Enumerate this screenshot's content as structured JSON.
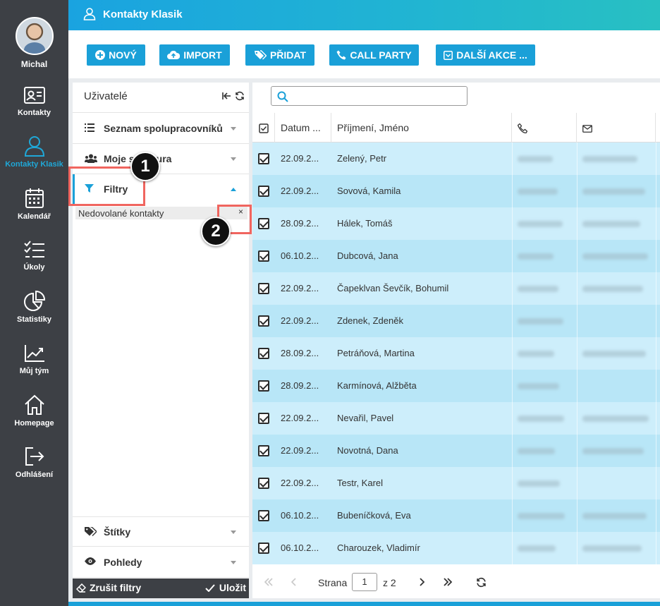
{
  "nav": {
    "user": {
      "name": "Michal"
    },
    "items": [
      {
        "label": "Kontakty",
        "icon": "contact-card-icon",
        "active": false
      },
      {
        "label": "Kontakty Klasik",
        "icon": "user-icon",
        "active": true
      },
      {
        "label": "Kalendář",
        "icon": "calendar-icon",
        "active": false
      },
      {
        "label": "Úkoly",
        "icon": "tasks-icon",
        "active": false
      },
      {
        "label": "Statistiky",
        "icon": "pie-chart-icon",
        "active": false
      },
      {
        "label": "Můj tým",
        "icon": "trend-chart-icon",
        "active": false
      },
      {
        "label": "Homepage",
        "icon": "home-icon",
        "active": false
      },
      {
        "label": "Odhlášení",
        "icon": "logout-icon",
        "active": false
      }
    ]
  },
  "header": {
    "title": "Kontakty Klasik",
    "icon": "user-icon"
  },
  "toolbar": {
    "buttons": [
      {
        "label": "NOVÝ",
        "icon": "plus-circle-icon"
      },
      {
        "label": "IMPORT",
        "icon": "cloud-upload-icon"
      },
      {
        "label": "PŘIDAT",
        "icon": "tags-icon"
      },
      {
        "label": "CALL PARTY",
        "icon": "phone-icon"
      },
      {
        "label": "DALŠÍ AKCE ...",
        "icon": "dropdown-box-icon"
      }
    ]
  },
  "filter_panel": {
    "title": "Uživatelé",
    "sections": [
      {
        "label": "Seznam spolupracovníků",
        "icon": "list-icon",
        "expanded": false
      },
      {
        "label": "Moje struktura",
        "icon": "users-icon",
        "expanded": false
      },
      {
        "label": "Filtry",
        "icon": "filter-icon",
        "expanded": true
      },
      {
        "label": "Štítky",
        "icon": "tag-icon",
        "expanded": false
      },
      {
        "label": "Pohledy",
        "icon": "eye-icon",
        "expanded": false
      }
    ],
    "active_filter": {
      "label": "Nedovolané kontakty",
      "remove": "×"
    },
    "footer": {
      "clear_label": "Zrušit filtry",
      "save_label": "Uložit"
    }
  },
  "search": {
    "placeholder": "",
    "value": ""
  },
  "table": {
    "columns": [
      "Datum ...",
      "Příjmení, Jméno"
    ],
    "rows": [
      {
        "date": "22.09.2...",
        "name": "Zelený, Petr",
        "email": true
      },
      {
        "date": "22.09.2...",
        "name": "Sovová, Kamila",
        "email": true
      },
      {
        "date": "28.09.2...",
        "name": "Hálek, Tomáš",
        "email": true
      },
      {
        "date": "06.10.2...",
        "name": "Dubcová, Jana",
        "email": true
      },
      {
        "date": "22.09.2...",
        "name": "Čapeklvan Ševčík, Bohumil",
        "email": true
      },
      {
        "date": "22.09.2...",
        "name": "Zdenek, Zdeněk",
        "email": false
      },
      {
        "date": "28.09.2...",
        "name": "Petráňová, Martina",
        "email": true
      },
      {
        "date": "28.09.2...",
        "name": "Karmínová, Alžběta",
        "email": false
      },
      {
        "date": "22.09.2...",
        "name": "Nevařil, Pavel",
        "email": true
      },
      {
        "date": "22.09.2...",
        "name": "Novotná, Dana",
        "email": true
      },
      {
        "date": "22.09.2...",
        "name": "Testr, Karel",
        "email": false
      },
      {
        "date": "06.10.2...",
        "name": "Bubeníčková, Eva",
        "email": true
      },
      {
        "date": "06.10.2...",
        "name": "Charouzek, Vladimír",
        "email": true
      }
    ]
  },
  "pagination": {
    "page_label": "Strana",
    "page": "1",
    "of_label": "z 2"
  },
  "annotations": [
    {
      "label": "1"
    },
    {
      "label": "2"
    }
  ],
  "colors": {
    "accent": "#1aa0d8",
    "nav_bg": "#3d4045",
    "row_a": "#cdeefb",
    "row_b": "#b8e6f7",
    "highlight": "#f0655f"
  }
}
